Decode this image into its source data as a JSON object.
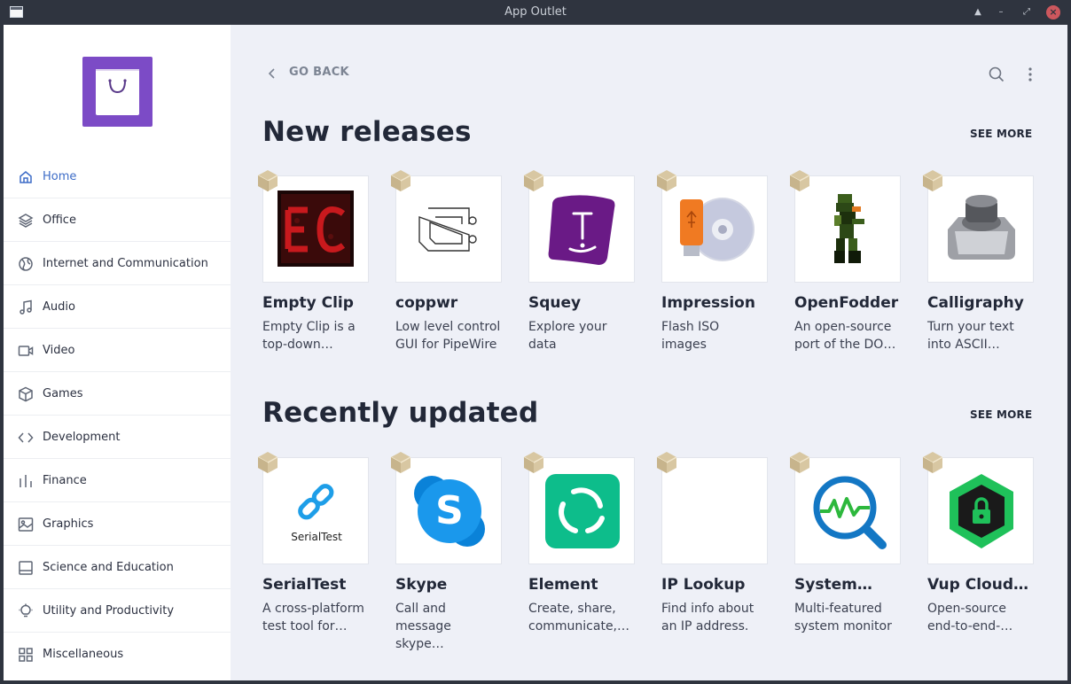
{
  "window": {
    "title": "App Outlet"
  },
  "sidebar": {
    "items": [
      {
        "label": "Home",
        "icon": "home-icon",
        "active": true
      },
      {
        "label": "Office",
        "icon": "layers-icon"
      },
      {
        "label": "Internet and Communication",
        "icon": "globe-icon"
      },
      {
        "label": "Audio",
        "icon": "music-note-icon"
      },
      {
        "label": "Video",
        "icon": "video-camera-icon"
      },
      {
        "label": "Games",
        "icon": "cube-icon"
      },
      {
        "label": "Development",
        "icon": "code-icon"
      },
      {
        "label": "Finance",
        "icon": "bar-chart-icon"
      },
      {
        "label": "Graphics",
        "icon": "image-icon"
      },
      {
        "label": "Science and Education",
        "icon": "book-icon"
      },
      {
        "label": "Utility and Productivity",
        "icon": "lightbulb-icon"
      },
      {
        "label": "Miscellaneous",
        "icon": "grid-icon"
      }
    ]
  },
  "header": {
    "go_back": "GO BACK"
  },
  "sections": [
    {
      "title": "New releases",
      "see_more": "SEE MORE",
      "apps": [
        {
          "name": "Empty Clip",
          "desc": "Empty Clip is a top-down…",
          "icon": "empty-clip-icon"
        },
        {
          "name": "coppwr",
          "desc": "Low level control GUI for PipeWire",
          "icon": "coppwr-icon"
        },
        {
          "name": "Squey",
          "desc": "Explore your data",
          "icon": "squey-icon"
        },
        {
          "name": "Impression",
          "desc": "Flash ISO images",
          "icon": "impression-icon"
        },
        {
          "name": "OpenFodder",
          "desc": "An open-source port of the DO…",
          "icon": "openfodder-icon"
        },
        {
          "name": "Calligraphy",
          "desc": "Turn your text into ASCII…",
          "icon": "calligraphy-icon"
        }
      ]
    },
    {
      "title": "Recently updated",
      "see_more": "SEE MORE",
      "apps": [
        {
          "name": "SerialTest",
          "desc": "A cross-platform test tool for…",
          "icon": "serialtest-icon",
          "icon_text": "SerialTest"
        },
        {
          "name": "Skype",
          "desc": "Call and message skype…",
          "icon": "skype-icon",
          "icon_text": "S"
        },
        {
          "name": "Element",
          "desc": "Create, share, communicate,…",
          "icon": "element-icon"
        },
        {
          "name": "IP Lookup",
          "desc": "Find info about an IP address.",
          "icon": "ip-lookup-icon"
        },
        {
          "name": "System…",
          "desc": "Multi-featured system monitor",
          "icon": "system-monitor-icon"
        },
        {
          "name": "Vup Cloud…",
          "desc": "Open-source end-to-end-…",
          "icon": "vup-cloud-icon"
        }
      ]
    }
  ],
  "colors": {
    "accent": "#3d6cc7",
    "logo": "#7c4bc6",
    "background": "#eef0f7"
  }
}
